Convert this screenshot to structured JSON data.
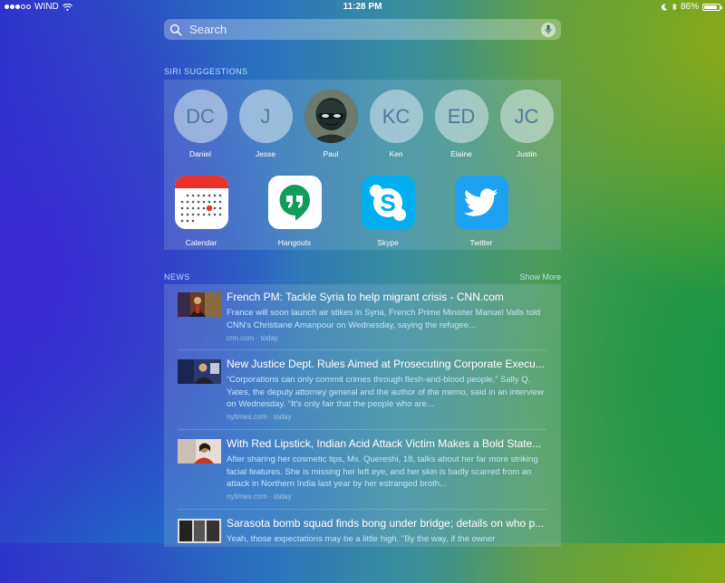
{
  "status": {
    "carrier": "WIND",
    "time": "11:28 PM",
    "battery": "86%",
    "battery_level": 0.86
  },
  "search": {
    "placeholder": "Search"
  },
  "siri": {
    "title": "SIRI SUGGESTIONS",
    "contacts": [
      {
        "initials": "DC",
        "name": "Daniel"
      },
      {
        "initials": "J",
        "name": "Jesse"
      },
      {
        "initials": "",
        "name": "Paul"
      },
      {
        "initials": "KC",
        "name": "Ken"
      },
      {
        "initials": "ED",
        "name": "Elaine"
      },
      {
        "initials": "JC",
        "name": "Justin"
      }
    ],
    "apps": [
      {
        "name": "Calendar",
        "icon": "calendar-icon"
      },
      {
        "name": "Hangouts",
        "icon": "hangouts-icon"
      },
      {
        "name": "Skype",
        "icon": "skype-icon"
      },
      {
        "name": "Twitter",
        "icon": "twitter-icon"
      }
    ]
  },
  "news": {
    "title": "NEWS",
    "show_more": "Show More",
    "items": [
      {
        "title": "French PM: Tackle Syria to help migrant crisis - CNN.com",
        "snippet": "France will soon launch air stikes in Syria, French Prime Minister Manuel Valls told CNN's Christiane Amanpour on Wednesday, saying the refugee...",
        "source": "cnn.com · today"
      },
      {
        "title": "New Justice Dept. Rules Aimed at Prosecuting Corporate Execu...",
        "snippet": "“Corporations can only commit crimes through flesh-and-blood people,” Sally Q. Yates, the deputy attorney general and the author of the memo, said in an interview on Wednesday. “It’s only fair that the people who are...",
        "source": "nytimes.com · today"
      },
      {
        "title": "With Red Lipstick, Indian Acid Attack Victim Makes a Bold State...",
        "snippet": "After sharing her cosmetic tips, Ms. Quereshi, 18, talks about her far more striking facial features. She is missing her left eye, and her skin is badly scarred from an attack in Northern India last year by her estranged broth...",
        "source": "nytimes.com · today"
      },
      {
        "title": "Sarasota bomb squad finds bong under bridge; details on who p...",
        "snippet": "Yeah, those expectations may be a little high.  \"By the way, if the owner",
        "source": ""
      }
    ]
  }
}
